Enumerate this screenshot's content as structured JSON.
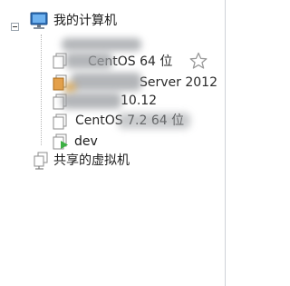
{
  "tree": {
    "root_label": "我的计算机",
    "vm_items": [
      {
        "label": "CentOS 64 位",
        "icon": "vm-icon",
        "redacted": true
      },
      {
        "label": "Server 2012",
        "icon": "vm-icon",
        "redacted": true
      },
      {
        "label": "10.12",
        "icon": "vm-icon",
        "redacted": true
      },
      {
        "label": "CentOS 7.2 64 位",
        "icon": "vm-icon",
        "redacted": true
      },
      {
        "label": "dev",
        "icon": "vm-running-icon",
        "redacted": false
      }
    ],
    "shared_label": "共享的虚拟机"
  },
  "icons": {
    "collapse": "minus-square-icon",
    "root": "computer-icon",
    "shared": "shared-vm-icon",
    "favorite": "star-icon"
  },
  "colors": {
    "running_green": "#3cb043",
    "monitor_blue": "#2f6fb7"
  }
}
